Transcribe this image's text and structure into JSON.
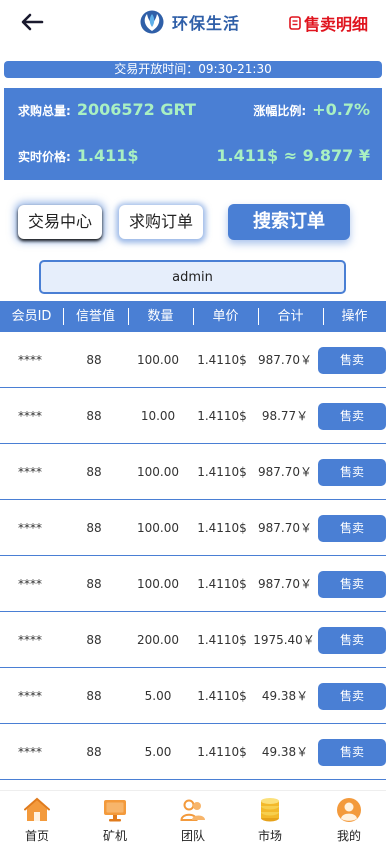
{
  "header": {
    "title": "环保生活",
    "detail_label": "售卖明细"
  },
  "banner": {
    "open_time": "交易开放时间：09:30-21:30"
  },
  "stats": {
    "total_label": "求购总量:",
    "total_value": "2006572 GRT",
    "change_label": "涨幅比例:",
    "change_value": "+0.7%",
    "price_label": "实时价格:",
    "price_value": "1.411$",
    "conversion": "1.411$ ≈ 9.877 ¥"
  },
  "actions": {
    "trade_center": "交易中心",
    "buy_orders": "求购订单",
    "search_orders": "搜索订单"
  },
  "search": {
    "value": "admin"
  },
  "table": {
    "headers": [
      "会员ID",
      "信誉值",
      "数量",
      "单价",
      "合计",
      "操作"
    ],
    "sell_label": "售卖",
    "rows": [
      {
        "member_id": "****",
        "credit": "88",
        "quantity": "100.00",
        "unit_price": "1.4110$",
        "total": "987.70￥"
      },
      {
        "member_id": "****",
        "credit": "88",
        "quantity": "10.00",
        "unit_price": "1.4110$",
        "total": "98.77￥"
      },
      {
        "member_id": "****",
        "credit": "88",
        "quantity": "100.00",
        "unit_price": "1.4110$",
        "total": "987.70￥"
      },
      {
        "member_id": "****",
        "credit": "88",
        "quantity": "100.00",
        "unit_price": "1.4110$",
        "total": "987.70￥"
      },
      {
        "member_id": "****",
        "credit": "88",
        "quantity": "100.00",
        "unit_price": "1.4110$",
        "total": "987.70￥"
      },
      {
        "member_id": "****",
        "credit": "88",
        "quantity": "200.00",
        "unit_price": "1.4110$",
        "total": "1975.40￥"
      },
      {
        "member_id": "****",
        "credit": "88",
        "quantity": "5.00",
        "unit_price": "1.4110$",
        "total": "49.38￥"
      },
      {
        "member_id": "****",
        "credit": "88",
        "quantity": "5.00",
        "unit_price": "1.4110$",
        "total": "49.38￥"
      }
    ]
  },
  "tabbar": {
    "items": [
      {
        "label": "首页",
        "icon": "home-icon"
      },
      {
        "label": "矿机",
        "icon": "monitor-icon"
      },
      {
        "label": "团队",
        "icon": "team-icon"
      },
      {
        "label": "市场",
        "icon": "coins-icon"
      },
      {
        "label": "我的",
        "icon": "profile-icon"
      }
    ]
  },
  "colors": {
    "primary": "#4a7fd4",
    "accent_green": "#a9f0c2",
    "detail_red": "#e0141e",
    "tab_orange": "#f39a3c"
  }
}
